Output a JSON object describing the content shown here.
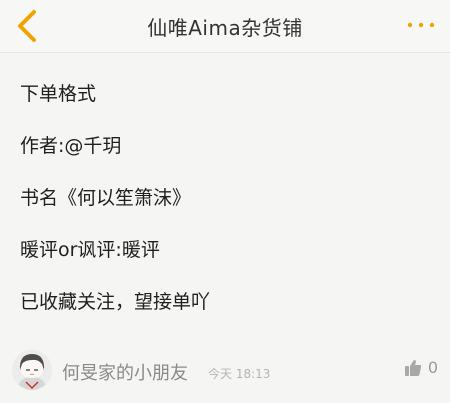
{
  "header": {
    "title": "仙唯Aima杂货铺",
    "back_icon": "chevron-left-icon",
    "more_icon": "ellipsis-icon",
    "accent_color": "#f0a400"
  },
  "post": {
    "lines": [
      "下单格式",
      "作者:@千玥",
      "书名《何以笙箫沫》",
      "暖评or讽评:暖评",
      "已收藏关注，望接单吖"
    ]
  },
  "comment": {
    "username": "何旻家的小朋友",
    "time": "今天 18:13",
    "like_count": "0",
    "like_icon": "thumbs-up-icon",
    "avatar_icon": "avatar"
  }
}
